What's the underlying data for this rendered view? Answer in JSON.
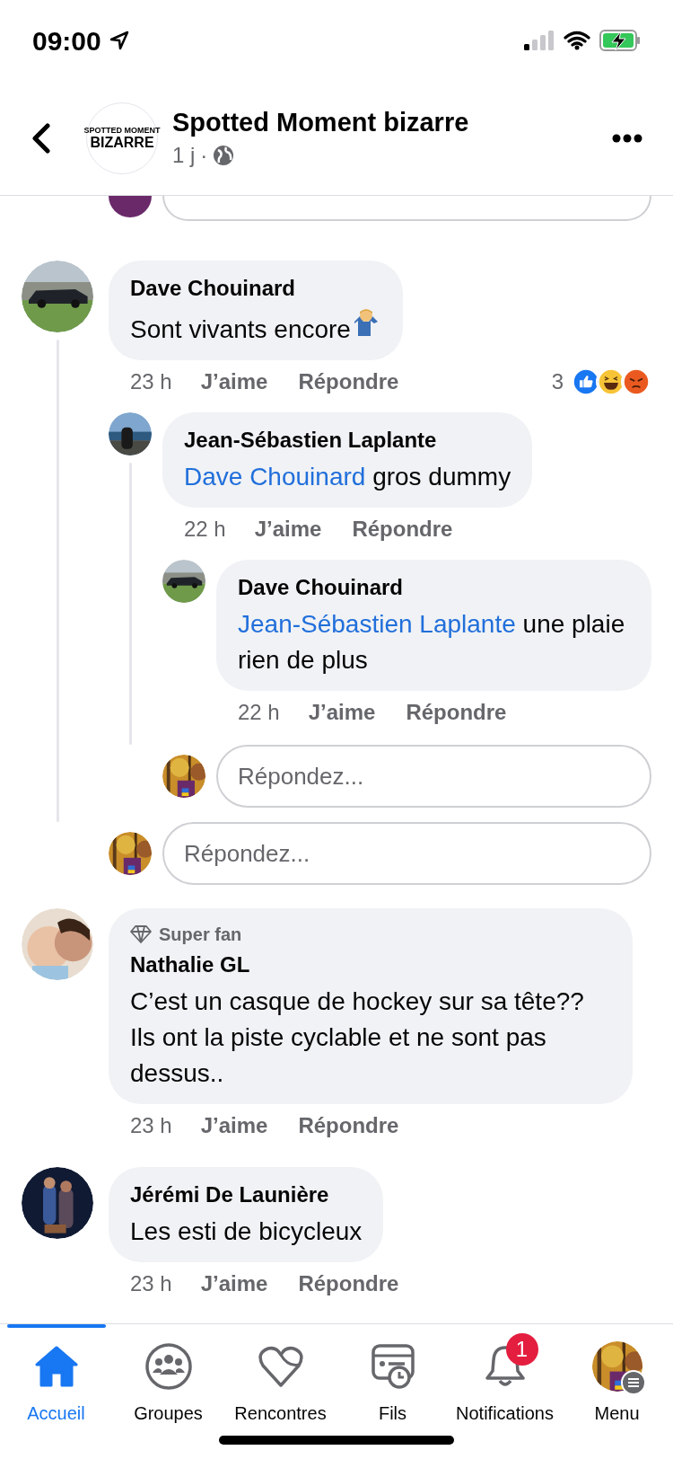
{
  "status_bar": {
    "time": "09:00"
  },
  "header": {
    "title": "Spotted Moment bizarre",
    "logo_top": "SPOTTED MOMENT",
    "logo_bottom": "BIZARRE",
    "age": "1 j",
    "separator": "·"
  },
  "comments": [
    {
      "author": "Dave Chouinard",
      "text": "Sont vivants encore",
      "emoji": {
        "kind": "shrug"
      },
      "time": "23 h",
      "like_label": "J’aime",
      "reply_label": "Répondre",
      "reaction_count": "3",
      "reactions": [
        {
          "kind": "like"
        },
        {
          "kind": "haha"
        },
        {
          "kind": "angry"
        }
      ],
      "replies": [
        {
          "author": "Jean-Sébastien Laplante",
          "mention": "Dave Chouinard",
          "text": "gros dummy",
          "time": "22 h",
          "like_label": "J’aime",
          "reply_label": "Répondre",
          "replies": [
            {
              "author": "Dave Chouinard",
              "mention": "Jean-Sébastien Laplante",
              "text": "une plaie rien de plus",
              "time": "22 h",
              "like_label": "J’aime",
              "reply_label": "Répondre"
            }
          ],
          "reply_field": {
            "placeholder": "Répondez..."
          }
        }
      ],
      "reply_field": {
        "placeholder": "Répondez..."
      }
    },
    {
      "badge": "Super fan",
      "author": "Nathalie GL",
      "text": "C’est un casque de hockey sur sa tête?? Ils ont la piste cyclable et ne sont pas dessus..",
      "time": "23 h",
      "like_label": "J’aime",
      "reply_label": "Répondre"
    },
    {
      "author": "Jérémi De Launière",
      "text": "Les esti de bicycleux",
      "time": "23 h",
      "like_label": "J’aime",
      "reply_label": "Répondre"
    }
  ],
  "tab_bar": [
    {
      "kind": "home",
      "label": "Accueil",
      "selected": true
    },
    {
      "kind": "groups",
      "label": "Groupes",
      "selected": false
    },
    {
      "kind": "dating",
      "label": "Rencontres",
      "selected": false
    },
    {
      "kind": "feeds",
      "label": "Fils",
      "selected": false
    },
    {
      "kind": "notifications",
      "label": "Notifications",
      "selected": false,
      "badge": "1"
    },
    {
      "kind": "menu",
      "label": "Menu",
      "selected": false
    }
  ]
}
